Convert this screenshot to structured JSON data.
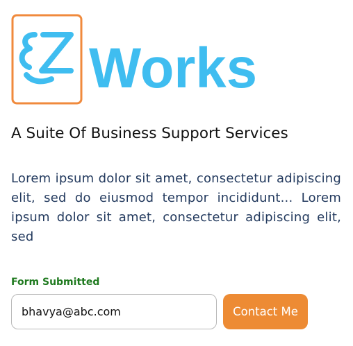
{
  "brand": {
    "logo_text": "EZ Works",
    "logo_colors": {
      "frame": "#f08a3c",
      "mark": "#3fbdf0",
      "wordmark": "#3fbdf0"
    }
  },
  "tagline": "A Suite Of Business Support Services",
  "description": "Lorem ipsum dolor sit amet, consectetur adipiscing elit, sed do eiusmod tempor incididunt... Lorem ipsum dolor sit amet, consectetur adipiscing elit, sed",
  "form": {
    "status": "Form Submitted",
    "email_value": "bhavya@abc.com",
    "submit_label": "Contact Me"
  },
  "colors": {
    "accent": "#ed8b34",
    "status_text": "#1f7a1f",
    "body_text": "#233a5e"
  }
}
